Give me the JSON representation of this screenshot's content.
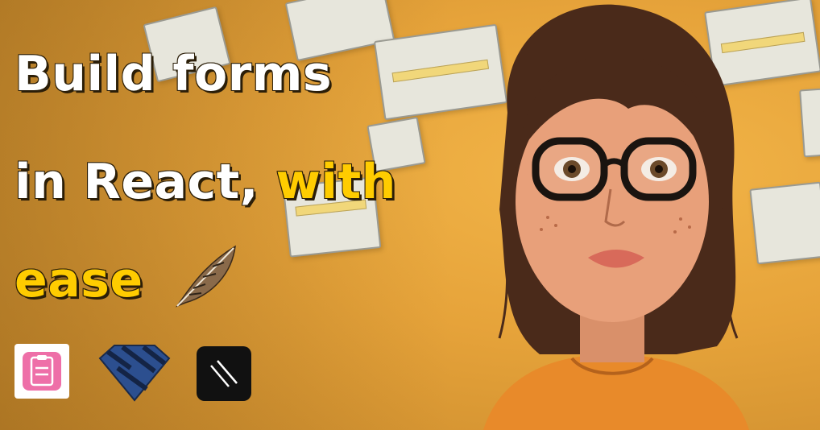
{
  "headline": {
    "line1": "Build forms",
    "line2_prefix": "in React,",
    "line2_highlight": "with",
    "line3": "ease"
  },
  "icons": {
    "feather": "feather-icon",
    "logo1": "clipboard-form-logo",
    "logo2": "blue-diamond-shield-logo",
    "logo3": "black-slash-logo",
    "portrait": "girl-with-glasses-illustration"
  },
  "colors": {
    "background": "#e6a33a",
    "text_white": "#ffffff",
    "text_yellow": "#ffcc00",
    "logo1_bg": "#ee6fa8",
    "logo2_fill": "#2c4f8f",
    "logo3_bg": "#111111"
  }
}
